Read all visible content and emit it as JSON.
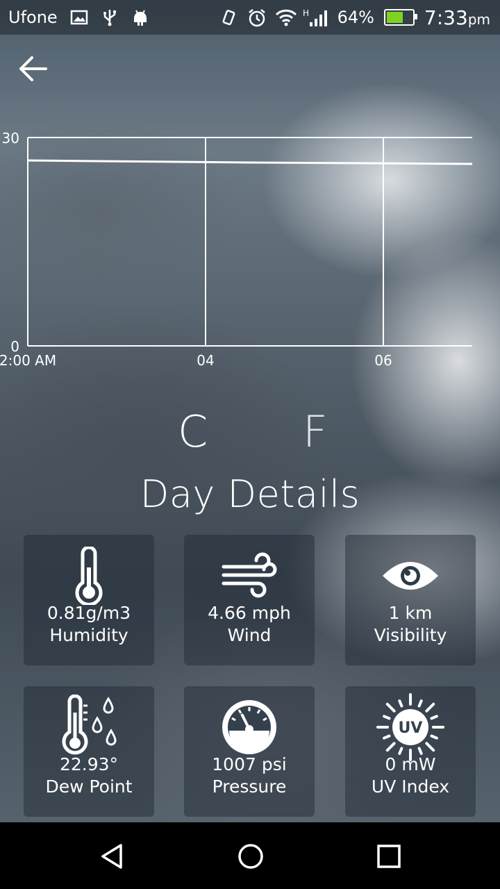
{
  "status_bar": {
    "carrier": "Ufone",
    "battery_percent": "64%",
    "battery_level": 0.64,
    "time": "7:33",
    "time_suffix": "pm",
    "icons": [
      "image-icon",
      "usb-icon",
      "android-icon",
      "vibrate-icon",
      "alarm-icon",
      "wifi-icon",
      "signal-icon",
      "battery-icon"
    ]
  },
  "chart_data": {
    "type": "line",
    "x_tick_labels": [
      "2:00 AM",
      "04",
      "06"
    ],
    "y_tick_labels": [
      "0",
      "30"
    ],
    "ylim": [
      0,
      30
    ],
    "series": [
      {
        "values": [
          26.7,
          26.4,
          26.2
        ]
      }
    ],
    "grid": true
  },
  "units": {
    "celsius": "C",
    "fahrenheit": "F"
  },
  "section_title": "Day Details",
  "tiles": [
    {
      "value": "0.81g/m3",
      "label": "Humidity",
      "icon": "thermometer-icon"
    },
    {
      "value": "4.66 mph",
      "label": "Wind",
      "icon": "wind-icon"
    },
    {
      "value": "1 km",
      "label": "Visibility",
      "icon": "eye-icon"
    },
    {
      "value": "22.93°",
      "label": "Dew Point",
      "icon": "dew-point-icon"
    },
    {
      "value": "1007 psi",
      "label": "Pressure",
      "icon": "gauge-icon"
    },
    {
      "value": "0 mW",
      "label": "UV Index",
      "icon": "uv-sun-icon"
    }
  ],
  "uv_badge": "UV",
  "nav": [
    "back-nav-icon",
    "home-nav-icon",
    "recents-nav-icon"
  ]
}
